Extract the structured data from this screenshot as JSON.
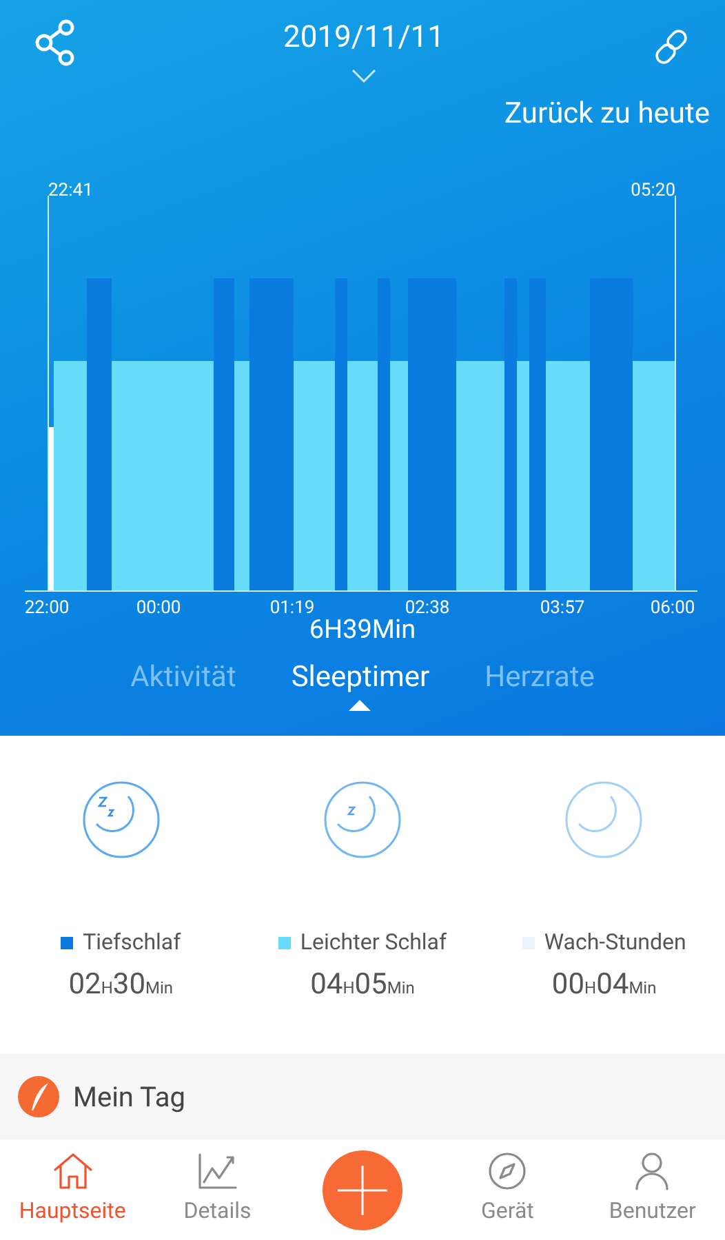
{
  "header": {
    "date": "2019/11/11",
    "back_link": "Zurück zu heute"
  },
  "sleep_chart": {
    "start_label": "22:41",
    "end_label": "05:20",
    "x_ticks": [
      "22:00",
      "00:00",
      "01:19",
      "02:38",
      "03:57",
      "06:00"
    ],
    "total": "6H39Min"
  },
  "tabs": [
    {
      "label": "Aktivität",
      "selected": false
    },
    {
      "label": "Sleeptimer",
      "selected": true
    },
    {
      "label": "Herzrate",
      "selected": false
    }
  ],
  "stages": [
    {
      "kind": "deep",
      "label": "Tiefschlaf",
      "color": "#0b7be0",
      "hours": "02",
      "hours_unit": "H",
      "minutes": "30",
      "minutes_unit": "Min"
    },
    {
      "kind": "light",
      "label": "Leichter Schlaf",
      "color": "#67dcfa",
      "hours": "04",
      "hours_unit": "H",
      "minutes": "05",
      "minutes_unit": "Min"
    },
    {
      "kind": "awake",
      "label": "Wach-Stunden",
      "color": "#eaf3fd",
      "hours": "00",
      "hours_unit": "H",
      "minutes": "04",
      "minutes_unit": "Min"
    }
  ],
  "my_day": {
    "title": "Mein Tag"
  },
  "nav": [
    {
      "kind": "home",
      "label": "Hauptseite",
      "selected": true
    },
    {
      "kind": "details",
      "label": "Details",
      "selected": false
    },
    {
      "kind": "add"
    },
    {
      "kind": "device",
      "label": "Gerät",
      "selected": false
    },
    {
      "kind": "user",
      "label": "Benutzer",
      "selected": false
    }
  ]
}
